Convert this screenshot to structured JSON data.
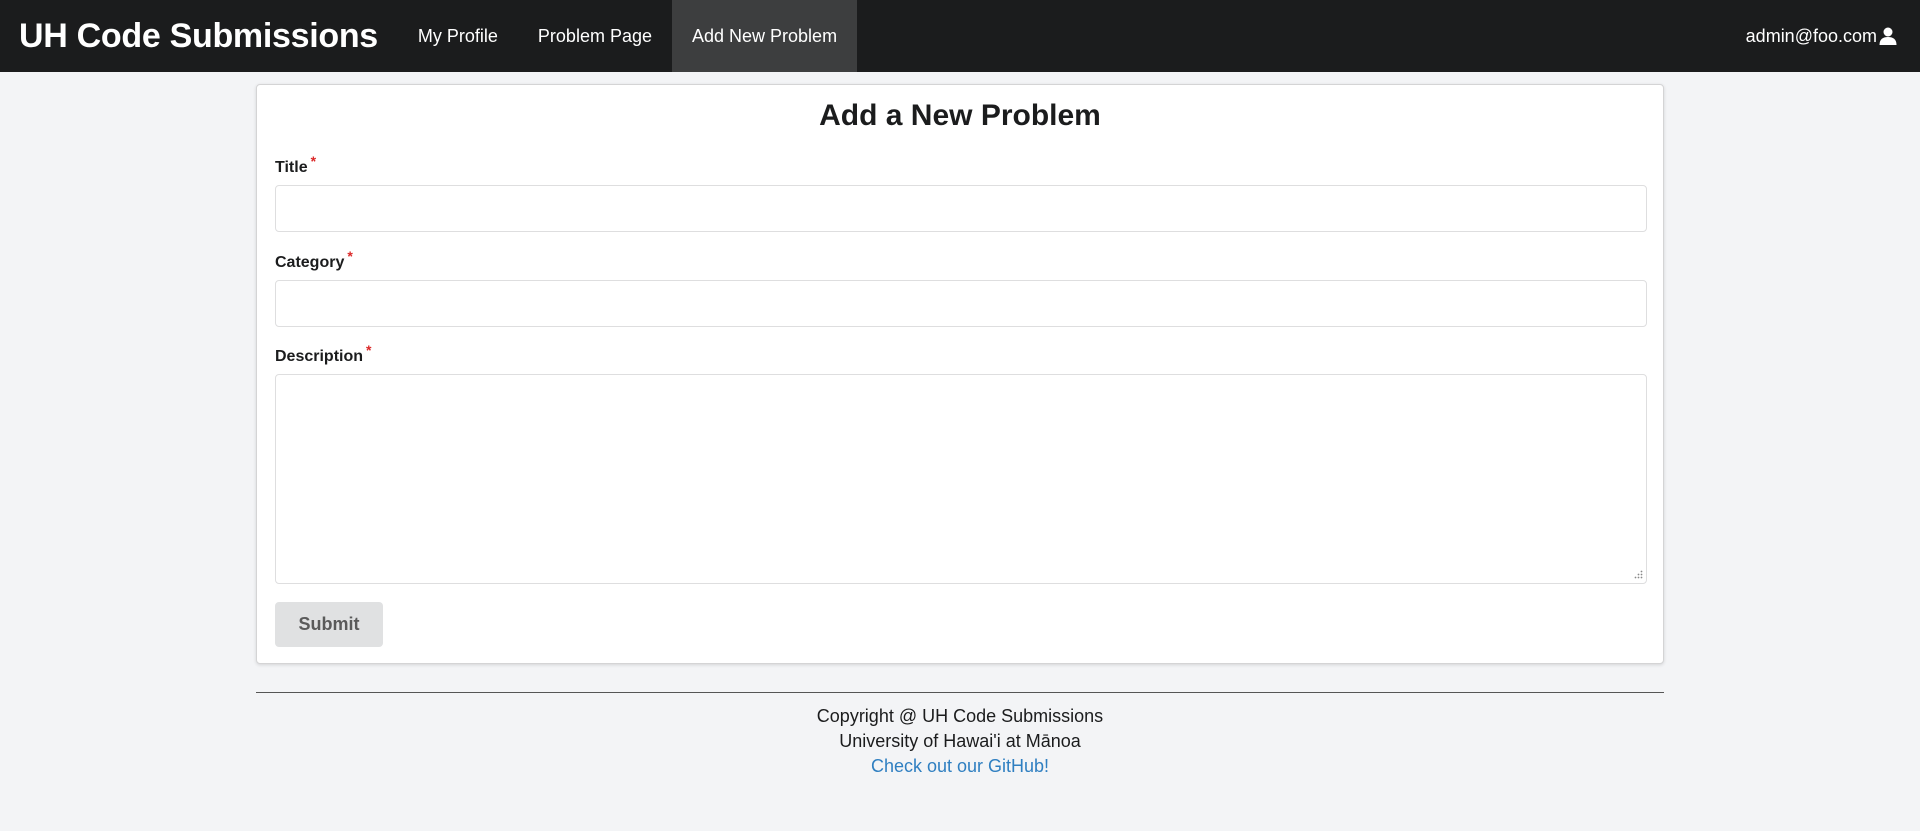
{
  "navbar": {
    "brand": "UH Code Submissions",
    "items": [
      {
        "label": "My Profile",
        "active": false
      },
      {
        "label": "Problem Page",
        "active": false
      },
      {
        "label": "Add New Problem",
        "active": true
      }
    ],
    "user_email": "admin@foo.com",
    "user_icon": "user-icon"
  },
  "form": {
    "title": "Add a New Problem",
    "fields": {
      "title": {
        "label": "Title",
        "required_mark": "*",
        "value": ""
      },
      "category": {
        "label": "Category",
        "required_mark": "*",
        "value": ""
      },
      "description": {
        "label": "Description",
        "required_mark": "*",
        "value": ""
      }
    },
    "submit_label": "Submit"
  },
  "footer": {
    "copyright": "Copyright @ UH Code Submissions",
    "university": "University of Hawai'i at Mānoa",
    "github_link": "Check out our GitHub!"
  },
  "colors": {
    "navbar_bg": "#1b1c1d",
    "active_tab_bg": "#3d3e3f",
    "page_bg": "#f3f4f6",
    "required": "#db2828",
    "link": "#2f7fc1",
    "button_bg": "#e0e1e2"
  }
}
